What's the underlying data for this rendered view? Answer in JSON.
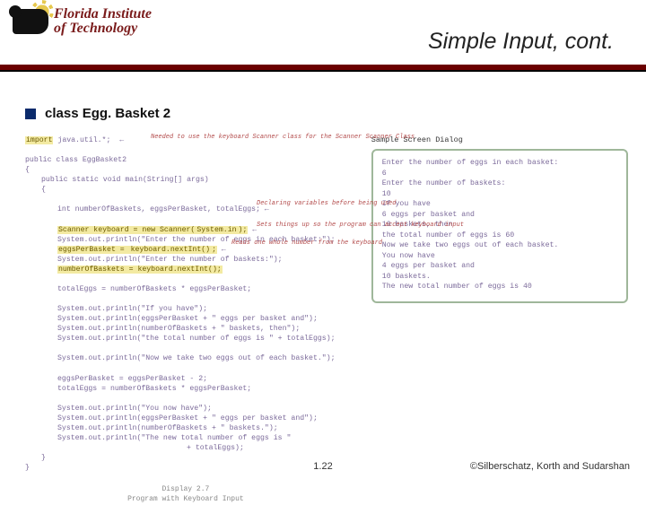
{
  "header": {
    "logo_line1": "Florida Institute",
    "logo_line2": "of Technology",
    "title": "Simple Input, cont."
  },
  "bullet": {
    "text": "class Egg. Basket 2"
  },
  "code": {
    "import_kw": "import",
    "import_pkg": "java.util.*;",
    "annot_import": "Needed to use the keyboard Scanner class\nfor the Scanner Scanner Class",
    "class_decl": "public class EggBasket2",
    "brace_open": "{",
    "main_sig": "public static void main(String[] args)",
    "brace_open2": "{",
    "decl": "int numberOfBaskets, eggsPerBasket, totalEggs;",
    "annot_decl": "Declaring variables\nbefore being used",
    "scanner_line_a": "Scanner keyboard = new Scanner(",
    "scanner_line_b": "System.in",
    "scanner_line_c": ");",
    "annot_scanner": "Sets things up so the program can\naccept keyboard input",
    "p1": "System.out.println(\"Enter the number of eggs in each basket:\");",
    "read1a": "eggsPerBasket = ",
    "read1b": "keyboard.nextInt()",
    "read1c": ";",
    "annot_read": "Reads one whole number\nfrom the keyboard",
    "p2": "System.out.println(\"Enter the number of baskets:\");",
    "read2": "numberOfBaskets = keyboard.nextInt();",
    "calc1": "totalEggs = numberOfBaskets * eggsPerBasket;",
    "out1": "System.out.println(\"If you have\");",
    "out2": "System.out.println(eggsPerBasket + \" eggs per basket and\");",
    "out3": "System.out.println(numberOfBaskets + \" baskets, then\");",
    "out4": "System.out.println(\"the total number of eggs is \" + totalEggs);",
    "out5": "System.out.println(\"Now we take two eggs out of each basket.\");",
    "calc2": "eggsPerBasket = eggsPerBasket - 2;",
    "calc3": "totalEggs = numberOfBaskets * eggsPerBasket;",
    "out6": "System.out.println(\"You now have\");",
    "out7": "System.out.println(eggsPerBasket + \" eggs per basket and\");",
    "out8": "System.out.println(numberOfBaskets + \" baskets.\");",
    "out9a": "System.out.println(\"The new total number of eggs is \"",
    "out9b": "+ totalEggs);",
    "brace_close2": "}",
    "brace_close": "}"
  },
  "dialog": {
    "heading": "Sample Screen Dialog",
    "l1": "Enter the number of eggs in each basket:",
    "l2": "6",
    "l3": "Enter the number of baskets:",
    "l4": "10",
    "l5": "If you have",
    "l6": "6 eggs per basket and",
    "l7": "10 baskets, then",
    "l8": "the total number of eggs is 60",
    "l9": "Now we take two eggs out of each basket.",
    "l10": "You now have",
    "l11": "4 eggs per basket and",
    "l12": "10 baskets.",
    "l13": "The new total number of eggs is 40"
  },
  "caption": {
    "l1": "Display 2.7",
    "l2": "Program with Keyboard Input"
  },
  "footer": {
    "page": "1.22",
    "copyright": "©Silberschatz, Korth and Sudarshan"
  }
}
